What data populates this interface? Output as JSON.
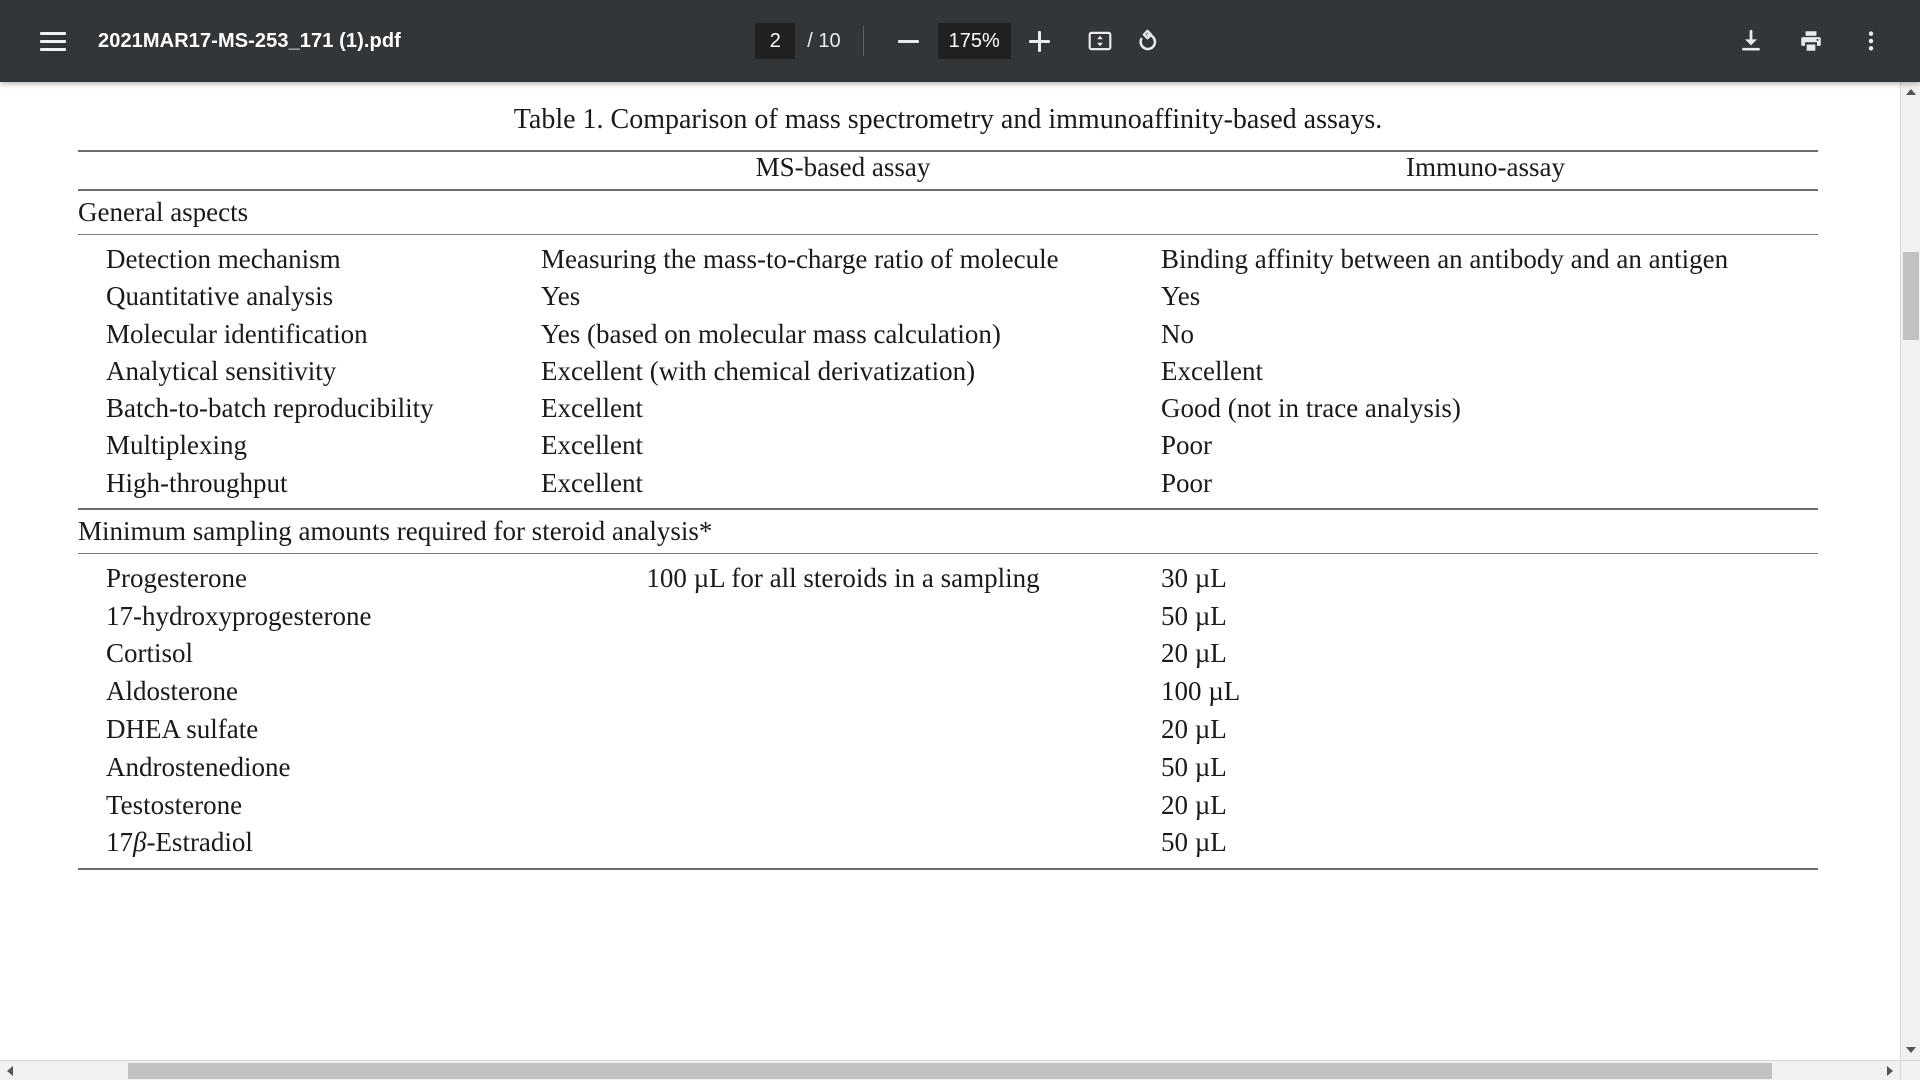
{
  "toolbar": {
    "menu_icon": "hamburger-menu-icon",
    "document_title": "2021MAR17-MS-253_171 (1).pdf",
    "page_number": "2",
    "page_count": "/ 10",
    "zoom_out_icon": "minus-icon",
    "zoom_level": "175%",
    "zoom_in_icon": "plus-icon",
    "fit_page_icon": "fit-to-page-icon",
    "rotate_icon": "rotate-counterclockwise-icon",
    "download_icon": "download-icon",
    "print_icon": "print-icon",
    "more_icon": "more-vertical-icon",
    "background_color": "#323639",
    "field_background_color": "#1f2123",
    "text_color": "#ffffff"
  },
  "document": {
    "caption": "Table 1.  Comparison of mass spectrometry and immunoaffinity-based assays.",
    "columns": {
      "label": "",
      "ms": "MS-based assay",
      "immuno": "Immuno-assay"
    },
    "sections": [
      {
        "title": "General aspects",
        "rows": [
          {
            "label": "Detection mechanism",
            "ms": "Measuring the mass-to-charge ratio of molecule",
            "immuno": "Binding affinity between an antibody and an antigen"
          },
          {
            "label": "Quantitative analysis",
            "ms": "Yes",
            "immuno": "Yes"
          },
          {
            "label": "Molecular identification",
            "ms": "Yes (based on molecular mass calculation)",
            "immuno": "No"
          },
          {
            "label": "Analytical sensitivity",
            "ms": "Excellent (with chemical derivatization)",
            "immuno": "Excellent"
          },
          {
            "label": "Batch-to-batch reproducibility",
            "ms": "Excellent",
            "immuno": "Good (not in trace analysis)"
          },
          {
            "label": "Multiplexing",
            "ms": "Excellent",
            "immuno": "Poor"
          },
          {
            "label": "High-throughput",
            "ms": "Excellent",
            "immuno": "Poor"
          }
        ]
      },
      {
        "title": "Minimum sampling amounts required for steroid analysis*",
        "merged_ms_value": "100 µL for all steroids in a sampling",
        "rows": [
          {
            "label": "Progesterone",
            "immuno": "30 µL"
          },
          {
            "label": "17-hydroxyprogesterone",
            "immuno": "50 µL"
          },
          {
            "label": "Cortisol",
            "immuno": "20 µL"
          },
          {
            "label": "Aldosterone",
            "immuno": "100 µL"
          },
          {
            "label": "DHEA sulfate",
            "immuno": "20 µL"
          },
          {
            "label": "Androstenedione",
            "immuno": "50 µL"
          },
          {
            "label": "Testosterone",
            "immuno": "20 µL"
          },
          {
            "label_pre": "17",
            "label_italic": "β",
            "label_post": "-Estradiol",
            "label": "17β-Estradiol",
            "immuno": "50 µL"
          }
        ]
      }
    ],
    "rule_color": "#6d6d6d",
    "page_background": "#ffffff",
    "text_color": "#1a1a1a"
  },
  "scrollbars": {
    "vertical_up_icon": "scroll-up-arrow-icon",
    "vertical_down_icon": "scroll-down-arrow-icon",
    "horizontal_left_icon": "scroll-left-arrow-icon",
    "horizontal_right_icon": "scroll-right-arrow-icon",
    "track_color": "#f1f1f1",
    "thumb_color": "#c1c1c1"
  }
}
